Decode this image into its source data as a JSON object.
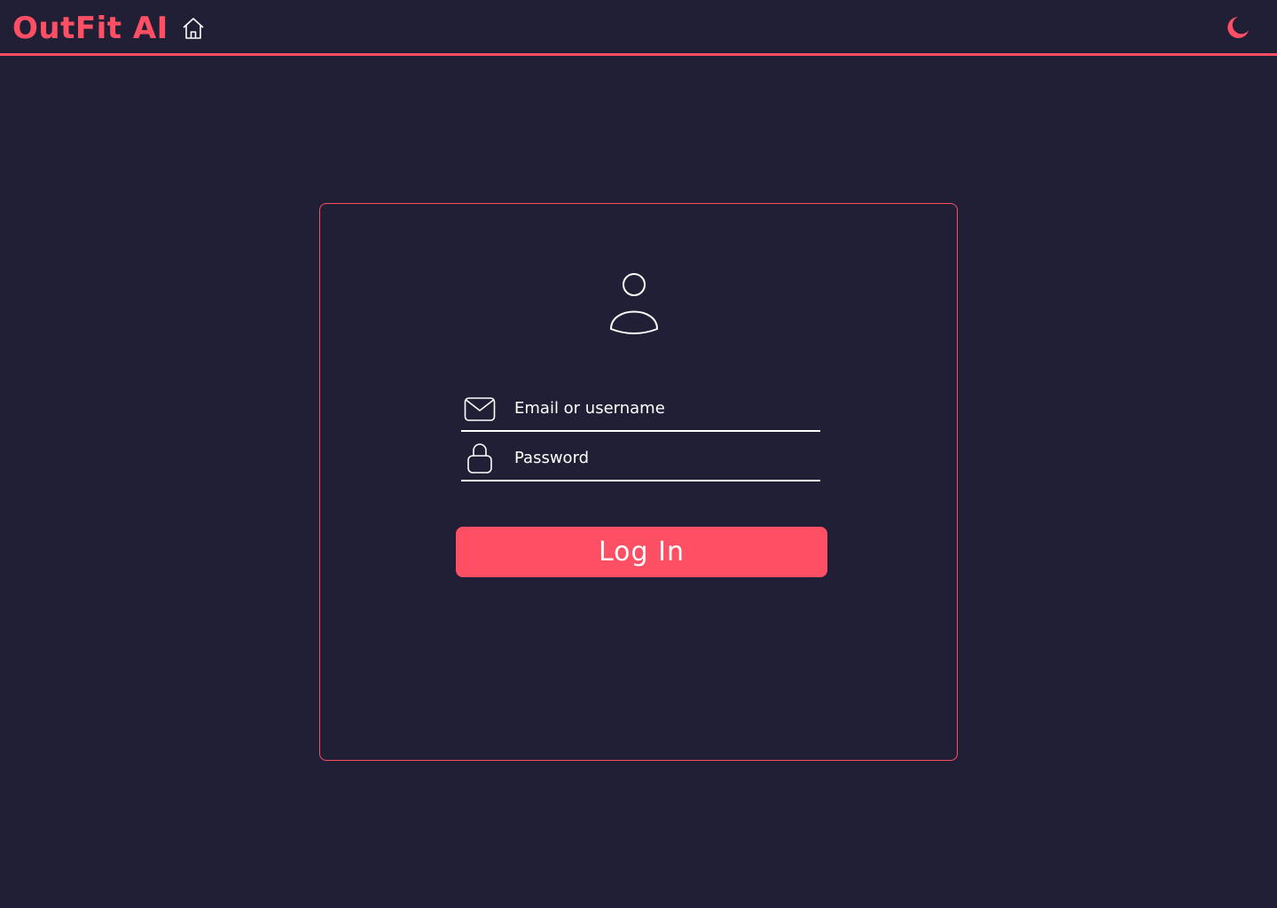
{
  "header": {
    "brand": "OutFit AI",
    "home_icon": "home-icon",
    "theme_icon": "moon-icon"
  },
  "login": {
    "avatar_icon": "user-icon",
    "email": {
      "icon": "envelope-icon",
      "placeholder": "Email or username",
      "value": ""
    },
    "password": {
      "icon": "lock-icon",
      "placeholder": "Password",
      "value": ""
    },
    "submit_label": "Log In"
  },
  "colors": {
    "background": "#201f36",
    "accent": "#ff4f64",
    "text": "#ffffff"
  }
}
